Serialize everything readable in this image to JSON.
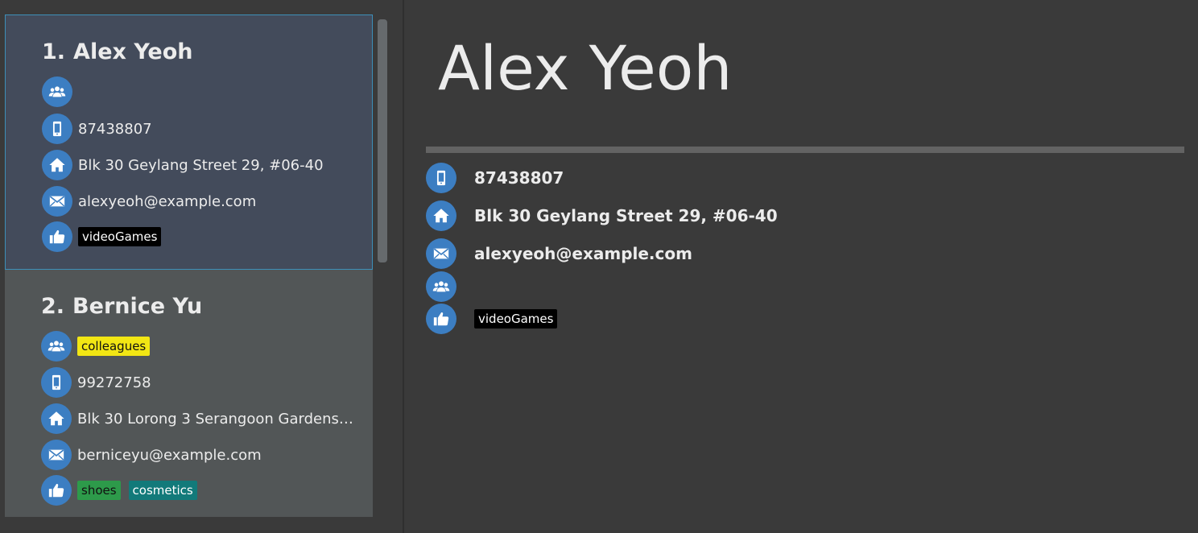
{
  "persons": [
    {
      "index": "1.",
      "name": "Alex Yeoh",
      "phone": "87438807",
      "address": "Blk 30 Geylang Street 29, #06-40",
      "email": "alexyeoh@example.com",
      "groups": [],
      "tags": [
        "videoGames"
      ]
    },
    {
      "index": "2.",
      "name": "Bernice Yu",
      "phone": "99272758",
      "address": "Blk 30 Lorong 3 Serangoon Gardens, #...",
      "email": "berniceyu@example.com",
      "groups": [
        "colleagues"
      ],
      "tags": [
        "shoes",
        "cosmetics"
      ]
    }
  ],
  "detail": {
    "name": "Alex Yeoh",
    "phone": "87438807",
    "address": "Blk 30 Geylang Street 29, #06-40",
    "email": "alexyeoh@example.com",
    "tags": [
      "videoGames"
    ]
  },
  "icons": {
    "group": "group-icon",
    "phone": "phone-icon",
    "address": "home-icon",
    "email": "email-icon",
    "tags": "thumbs-up-icon"
  },
  "colors": {
    "icon_circle": "#3c7ec2",
    "selected_card": "#434b5b",
    "selected_border": "#3d8fb8",
    "card": "#525657",
    "background": "#3a3a3a",
    "tag_videoGames": "#000000",
    "tag_colleagues": "#f2e614",
    "tag_shoes": "#2d9a4a",
    "tag_cosmetics": "#127a7a"
  }
}
